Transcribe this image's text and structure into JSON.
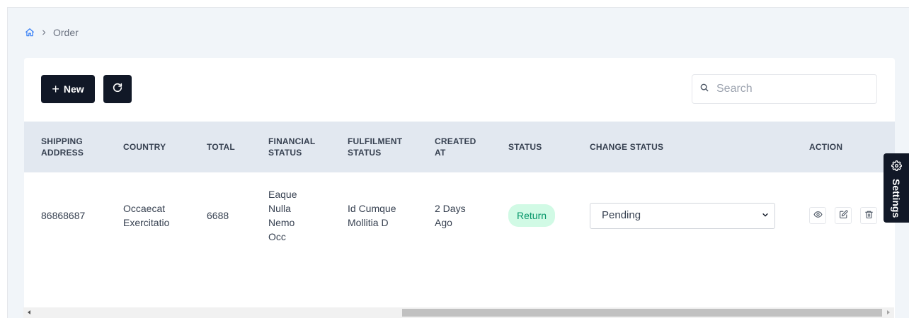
{
  "breadcrumb": {
    "current": "Order"
  },
  "toolbar": {
    "new_label": "New"
  },
  "search": {
    "placeholder": "Search"
  },
  "table": {
    "headers": {
      "shipping_address": "SHIPPING ADDRESS",
      "country": "COUNTRY",
      "total": "TOTAL",
      "financial_status": "FINANCIAL STATUS",
      "fulfilment_status": "FULFILMENT STATUS",
      "created_at": "CREATED AT",
      "status": "STATUS",
      "change_status": "CHANGE STATUS",
      "action": "ACTION"
    },
    "rows": [
      {
        "shipping_address": "86868687",
        "country": "Occaecat Exercitatio",
        "total": "6688",
        "financial_status": "Eaque Nulla Nemo Occ",
        "fulfilment_status": "Id Cumque Mollitia D",
        "created_at": "2 Days Ago",
        "status": "Return",
        "change_status": "Pending"
      }
    ]
  },
  "settings_tab": {
    "label": "Settings"
  },
  "colors": {
    "primary_dark": "#111827",
    "header_bg": "#e2e8f0",
    "page_bg": "#f1f5f9",
    "badge_bg": "#d1fae5",
    "badge_text": "#059669",
    "home_icon": "#3b82f6"
  }
}
